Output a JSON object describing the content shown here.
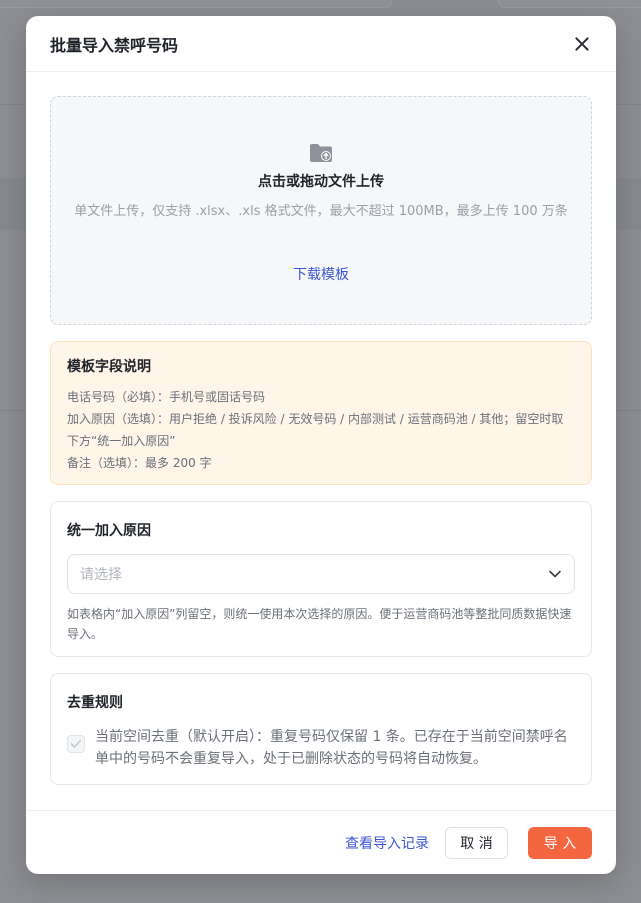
{
  "modal": {
    "title": "批量导入禁呼号码"
  },
  "upload": {
    "icon": "folder-upload-icon",
    "title": "点击或拖动文件上传",
    "description": "单文件上传，仅支持 .xlsx、.xls 格式文件，最大不超过 100MB，最多上传 100 万条",
    "download_label": "下载模板"
  },
  "notice": {
    "title": "模板字段说明",
    "lines": [
      "电话号码（必填）：手机号或固话号码",
      "加入原因（选填）：用户拒绝 / 投诉风险 / 无效号码 / 内部测试 / 运营商码池 / 其他；留空时取下方“统一加入原因”",
      "备注（选填）：最多 200 字"
    ]
  },
  "reason": {
    "title": "统一加入原因",
    "placeholder": "请选择",
    "hint": "如表格内“加入原因”列留空，则统一使用本次选择的原因。便于运营商码池等整批同质数据快速导入。"
  },
  "dedupe": {
    "title": "去重规则",
    "checked": true,
    "text": "当前空间去重（默认开启）：重复号码仅保留 1 条。已存在于当前空间禁呼名单中的号码不会重复导入，处于已删除状态的号码将自动恢复。"
  },
  "footer": {
    "records_label": "查看导入记录",
    "cancel_label": "取 消",
    "ok_label": "导 入"
  },
  "colors": {
    "primary_link": "#3f56d4",
    "ok_button": "#f4663f",
    "notice_bg": "#fff5e8"
  }
}
